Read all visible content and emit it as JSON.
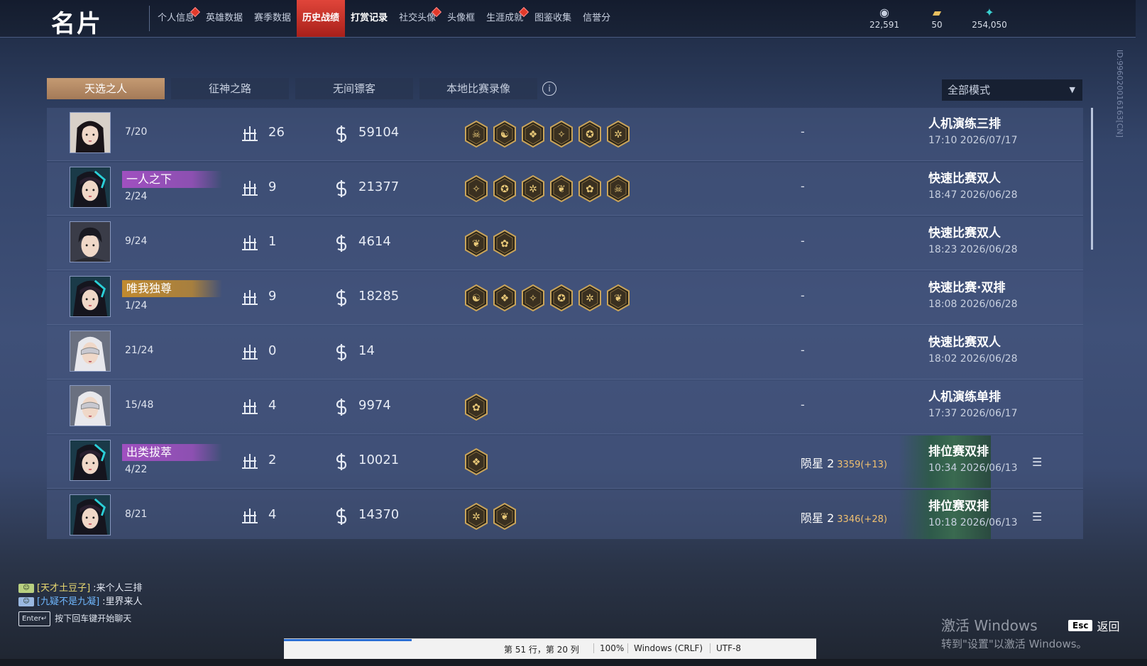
{
  "header": {
    "title": "名片",
    "nav": [
      {
        "label": "个人信息",
        "dot": true,
        "state": "normal"
      },
      {
        "label": "英雄数据",
        "dot": false,
        "state": "normal"
      },
      {
        "label": "赛季数据",
        "dot": false,
        "state": "normal"
      },
      {
        "label": "历史战绩",
        "dot": false,
        "state": "active"
      },
      {
        "label": "打赏记录",
        "dot": false,
        "state": "bold"
      },
      {
        "label": "社交头像",
        "dot": true,
        "state": "normal"
      },
      {
        "label": "头像框",
        "dot": false,
        "state": "normal"
      },
      {
        "label": "生涯成就",
        "dot": true,
        "state": "normal"
      },
      {
        "label": "图鉴收集",
        "dot": false,
        "state": "normal"
      },
      {
        "label": "信誉分",
        "dot": false,
        "state": "normal"
      }
    ],
    "currencies": [
      {
        "icon": "mask-currency-icon",
        "value": "22,591"
      },
      {
        "icon": "ticket-currency-icon",
        "value": "50"
      },
      {
        "icon": "feather-currency-icon",
        "value": "254,050"
      }
    ],
    "id_text": "ID:996020016163[CN]"
  },
  "tabs": [
    "天选之人",
    "征神之路",
    "无间镖客",
    "本地比赛录像"
  ],
  "active_tab": 0,
  "mode_select": {
    "value": "全部模式"
  },
  "matches": [
    {
      "avatar": "girl",
      "badge": "",
      "placement": "7/20",
      "kills": "26",
      "gold": "59104",
      "medals": 6,
      "rank": "-",
      "points": "",
      "mode": "人机演练三排",
      "time": "17:10  2026/07/17",
      "detail": false
    },
    {
      "avatar": "hood",
      "badge": "一人之下",
      "badge_color": "#a050c0",
      "placement": "2/24",
      "kills": "9",
      "gold": "21377",
      "medals": 6,
      "rank": "-",
      "points": "",
      "mode": "快速比赛双人",
      "time": "18:47  2026/06/28",
      "detail": false
    },
    {
      "avatar": "boy",
      "badge": "",
      "placement": "9/24",
      "kills": "1",
      "gold": "4614",
      "medals": 2,
      "rank": "-",
      "points": "",
      "mode": "快速比赛双人",
      "time": "18:23  2026/06/28",
      "detail": false
    },
    {
      "avatar": "hood",
      "badge": "唯我独尊",
      "badge_color": "#c08a30",
      "placement": "1/24",
      "kills": "9",
      "gold": "18285",
      "medals": 6,
      "rank": "-",
      "points": "",
      "mode": "快速比赛·双排",
      "time": "18:08  2026/06/28",
      "detail": false
    },
    {
      "avatar": "mask",
      "badge": "",
      "placement": "21/24",
      "kills": "0",
      "gold": "14",
      "medals": 0,
      "rank": "-",
      "points": "",
      "mode": "快速比赛双人",
      "time": "18:02  2026/06/28",
      "detail": false
    },
    {
      "avatar": "mask",
      "badge": "",
      "placement": "15/48",
      "kills": "4",
      "gold": "9974",
      "medals": 1,
      "rank": "-",
      "points": "",
      "mode": "人机演练单排",
      "time": "17:37  2026/06/17",
      "detail": false
    },
    {
      "avatar": "hood",
      "badge": "出类拔萃",
      "badge_color": "#a050c0",
      "placement": "4/22",
      "kills": "2",
      "gold": "10021",
      "medals": 1,
      "rank": "陨星 2",
      "points": "3359(+13)",
      "mode": "排位赛双排",
      "time": "10:34  2026/06/13",
      "detail": true
    },
    {
      "avatar": "hood",
      "badge": "",
      "placement": "8/21",
      "kills": "4",
      "gold": "14370",
      "medals": 2,
      "rank": "陨星 2",
      "points": "3346(+28)",
      "mode": "排位赛双排",
      "time": "10:18  2026/06/13",
      "detail": true
    }
  ],
  "chat": {
    "lines": [
      {
        "name": "[天才土豆子]",
        "msg": ":来个人三排"
      },
      {
        "name": "[九疑不是九凝]",
        "msg": ":里界来人"
      }
    ],
    "enter_key": "Enter↵",
    "hint": "按下回车键开始聊天"
  },
  "watermark": {
    "line1": "激活 Windows",
    "line2": "转到\"设置\"以激活 Windows。"
  },
  "esc": {
    "key": "Esc",
    "label": "返回"
  },
  "editor_status": {
    "position": "第 51 行，第 20 列",
    "zoom": "100%",
    "eol": "Windows (CRLF)",
    "encoding": "UTF-8"
  },
  "colors": {
    "accent_active": "#d83a30",
    "tab_active": "#b58a66",
    "points": "#f0c070"
  }
}
